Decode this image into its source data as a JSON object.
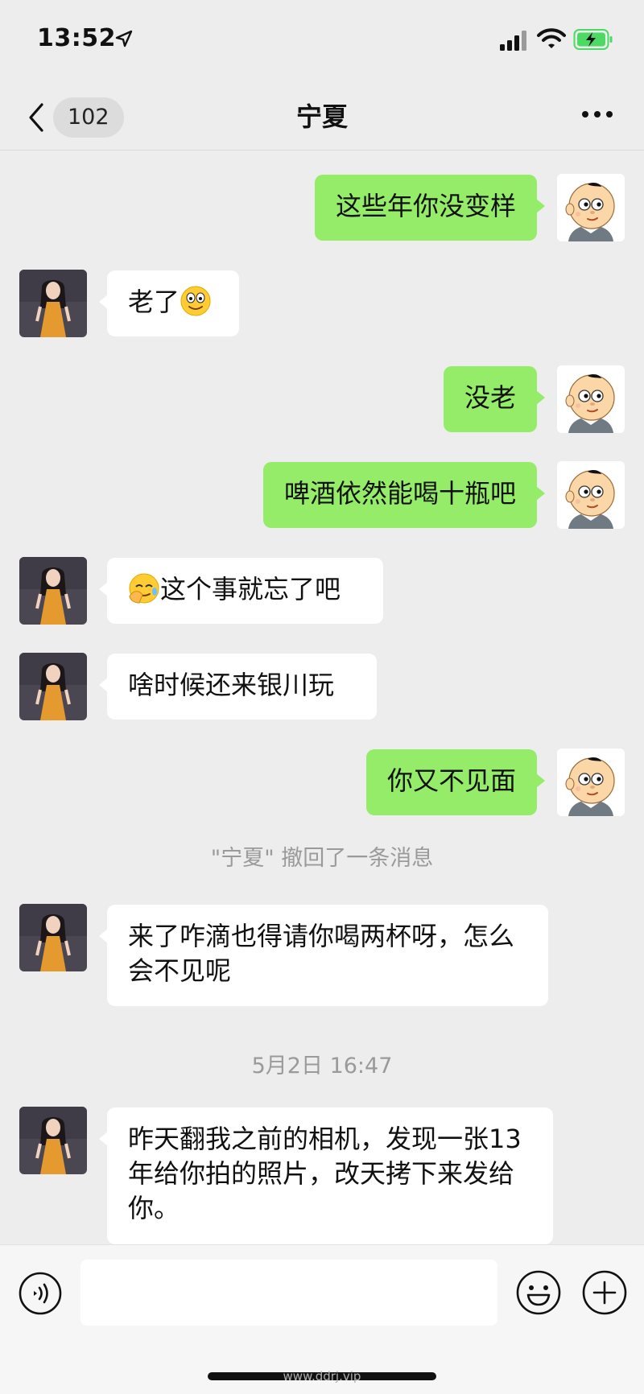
{
  "status_bar": {
    "time": "13:52",
    "icons": [
      "location-arrow-icon",
      "signal-icon",
      "wifi-icon",
      "battery-charging-icon"
    ],
    "battery_color": "#4cd964"
  },
  "nav": {
    "unread_count": "102",
    "title": "宁夏",
    "icons": [
      "chevron-left-icon",
      "more-icon"
    ]
  },
  "messages": [
    {
      "side": "mine",
      "text": "这些年你没变样"
    },
    {
      "side": "theirs",
      "text": "老了",
      "emoji": "smile-emoji"
    },
    {
      "side": "mine",
      "text": "没老"
    },
    {
      "side": "mine",
      "text": "啤酒依然能喝十瓶吧"
    },
    {
      "side": "theirs",
      "text": "这个事就忘了吧",
      "emoji": "facepalm-emoji"
    },
    {
      "side": "theirs",
      "text": "啥时候还来银川玩"
    },
    {
      "side": "mine",
      "text": "你又不见面"
    },
    {
      "type": "system",
      "text": "\"宁夏\" 撤回了一条消息"
    },
    {
      "side": "theirs",
      "text": "来了咋滴也得请你喝两杯呀，怎么会不见呢"
    },
    {
      "type": "timestamp",
      "text": "5月2日 16:47"
    },
    {
      "side": "theirs",
      "text": "昨天翻我之前的相机，发现一张13年给你拍的照片，改天拷下来发给你。"
    }
  ],
  "input_bar": {
    "value": "",
    "icons": [
      "voice-icon",
      "emoji-icon",
      "plus-icon"
    ]
  },
  "watermark": "www.ddrj.vip",
  "colors": {
    "background": "#ededed",
    "mine_bubble": "#95ec69",
    "theirs_bubble": "#ffffff"
  }
}
